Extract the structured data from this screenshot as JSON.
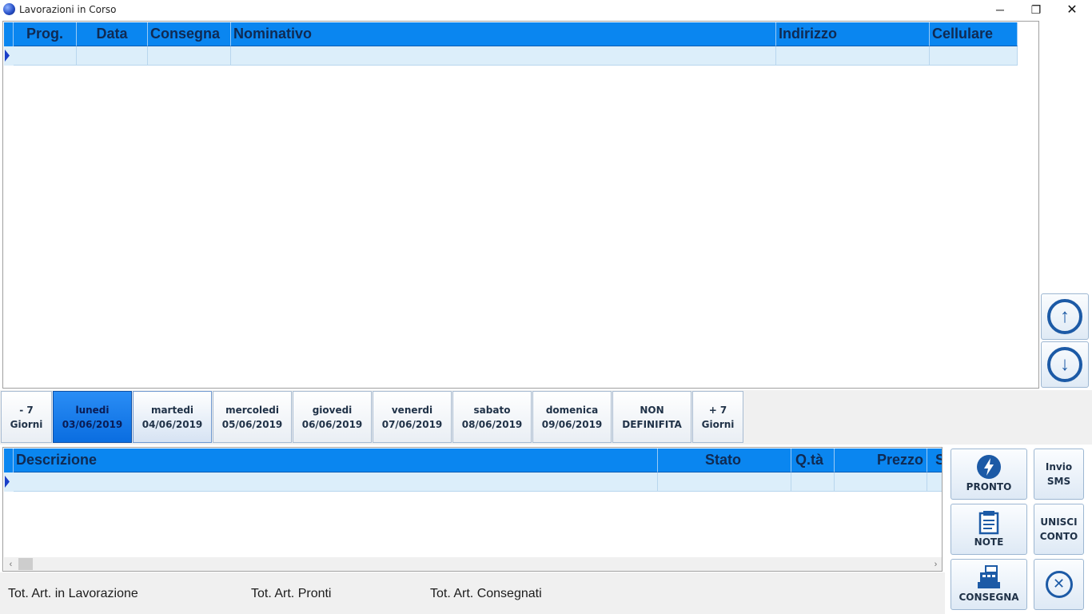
{
  "window": {
    "title": "Lavorazioni in Corso",
    "controls": {
      "minimize": "─",
      "restore": "❐",
      "close": "✕"
    }
  },
  "orders_grid": {
    "columns": [
      "Prog.",
      "Data",
      "Consegna",
      "Nominativo",
      "Indirizzo",
      "Cellulare"
    ],
    "rows": [
      [
        "",
        "",
        "",
        "",
        "",
        ""
      ]
    ]
  },
  "scroll": {
    "up_icon": "arrow-up-circle",
    "down_icon": "arrow-down-circle",
    "up_glyph": "↑",
    "down_glyph": "↓"
  },
  "day_tabs": [
    {
      "line1": "- 7",
      "line2": "Giorni",
      "state": "normal"
    },
    {
      "line1": "lunedi",
      "line2": "03/06/2019",
      "state": "active"
    },
    {
      "line1": "martedi",
      "line2": "04/06/2019",
      "state": "hover"
    },
    {
      "line1": "mercoledi",
      "line2": "05/06/2019",
      "state": "normal"
    },
    {
      "line1": "giovedi",
      "line2": "06/06/2019",
      "state": "normal"
    },
    {
      "line1": "venerdi",
      "line2": "07/06/2019",
      "state": "normal"
    },
    {
      "line1": "sabato",
      "line2": "08/06/2019",
      "state": "normal"
    },
    {
      "line1": "domenica",
      "line2": "09/06/2019",
      "state": "normal"
    },
    {
      "line1": "NON",
      "line2": "DEFINIFITA",
      "state": "normal"
    },
    {
      "line1": "+ 7",
      "line2": "Giorni",
      "state": "normal"
    }
  ],
  "items_grid": {
    "columns": [
      "Descrizione",
      "Stato",
      "Q.tà",
      "Prezzo",
      "S"
    ],
    "rows": [
      [
        "",
        "",
        "",
        "",
        ""
      ]
    ],
    "scroll_left": "‹",
    "scroll_right": "›"
  },
  "actions": {
    "pronto": "PRONTO",
    "note": "NOTE",
    "consegna": "CONSEGNA",
    "invio_sms_line1": "Invio",
    "invio_sms_line2": "SMS",
    "unisci_line1": "UNISCI",
    "unisci_line2": "CONTO",
    "close_glyph": "✕"
  },
  "totals": {
    "in_lavorazione": "Tot. Art. in Lavorazione",
    "pronti": "Tot. Art. Pronti",
    "consegnati": "Tot. Art. Consegnati"
  },
  "colors": {
    "header_blue": "#0a86f0",
    "row_bg": "#dceefa",
    "icon_blue": "#1c5aa6"
  }
}
